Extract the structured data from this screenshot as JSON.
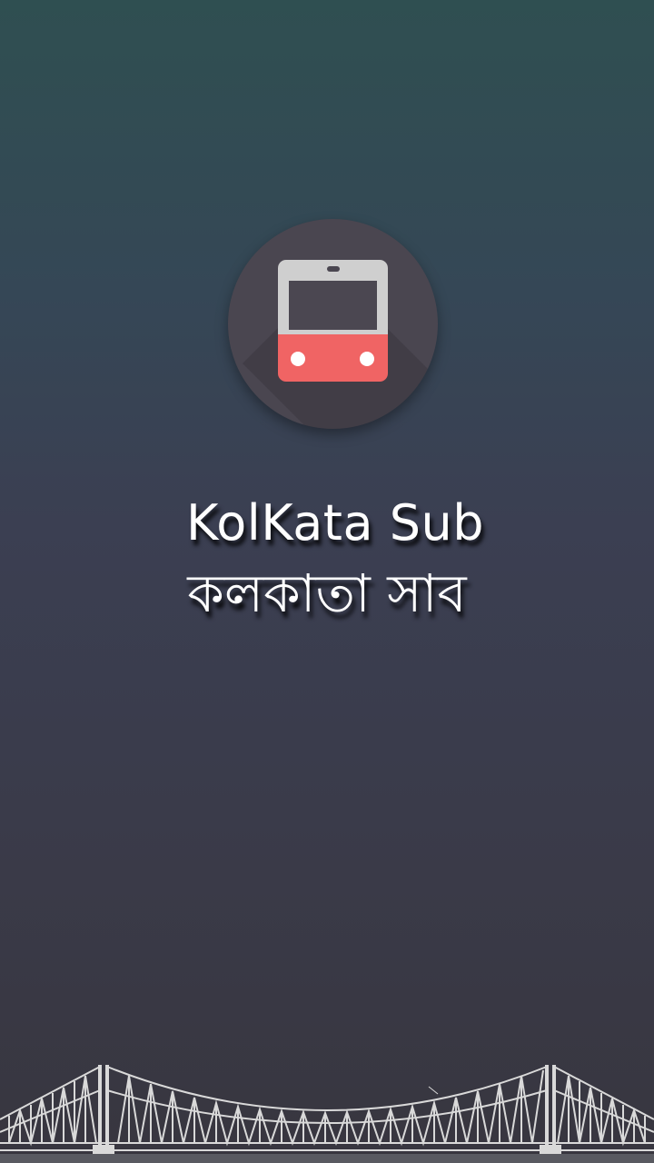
{
  "app": {
    "title_english": "KolKata Sub",
    "title_bengali": "কলকাতা সাব"
  },
  "logo": {
    "icon": "train-icon",
    "circle_color": "#4a4650",
    "train_top_color": "#cfcfcf",
    "train_bottom_color": "#f06464"
  },
  "footer": {
    "illustration": "bridge-icon"
  },
  "colors": {
    "background_top": "#2f4f51",
    "background_bottom": "#38363f",
    "text": "#ffffff"
  }
}
